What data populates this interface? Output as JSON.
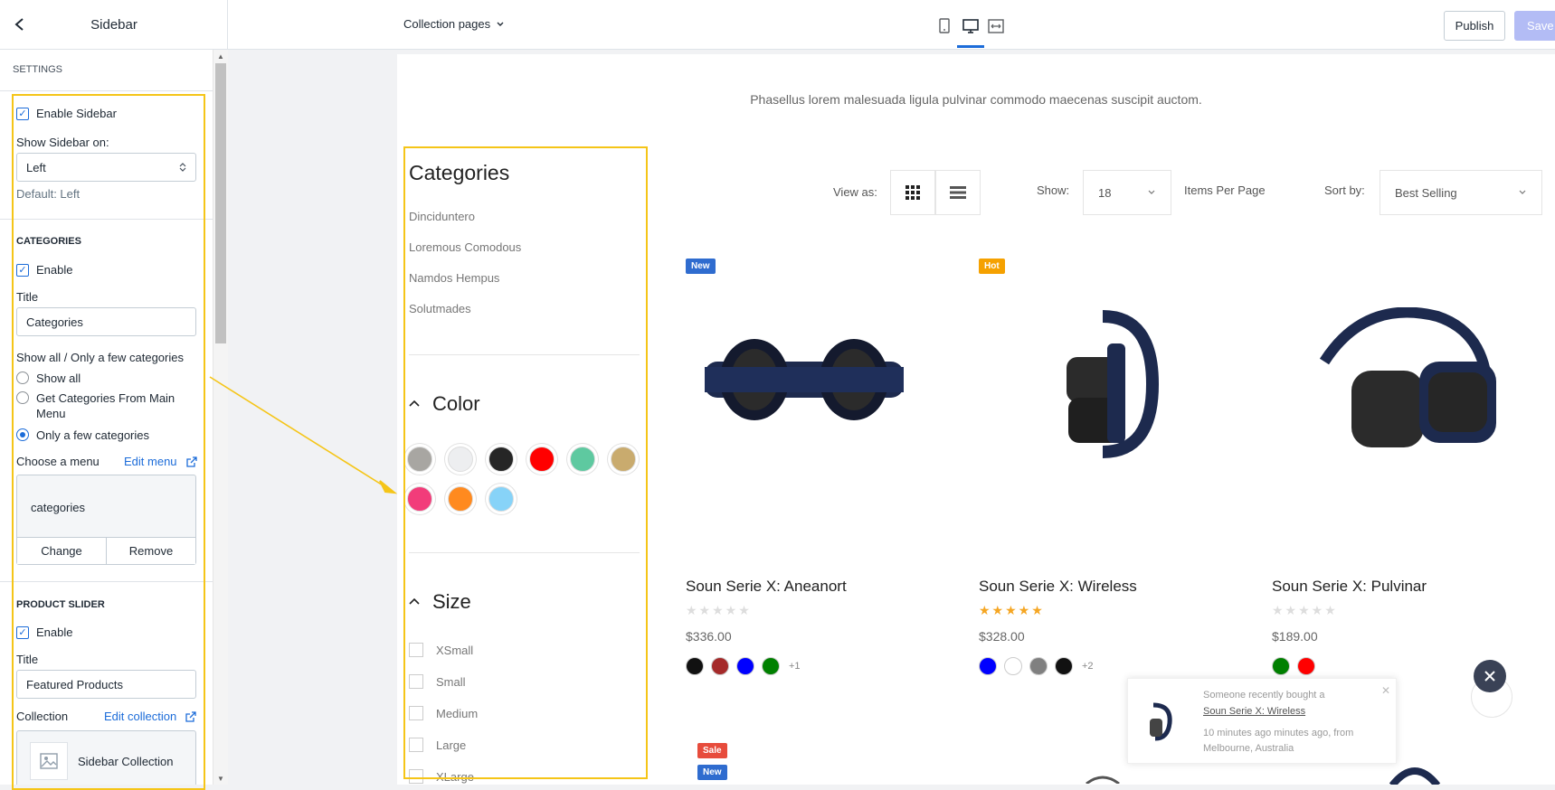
{
  "topbar": {
    "title": "Sidebar",
    "page_selector": "Collection pages",
    "publish_label": "Publish",
    "save_label": "Save"
  },
  "panel": {
    "settings_heading": "SETTINGS",
    "enable_sidebar_label": "Enable Sidebar",
    "show_sidebar_on_label": "Show Sidebar on:",
    "show_sidebar_on_value": "Left",
    "default_hint": "Default: Left",
    "categories": {
      "heading": "CATEGORIES",
      "enable_label": "Enable",
      "title_label": "Title",
      "title_value": "Categories",
      "show_label": "Show all / Only a few categories",
      "options": [
        "Show all",
        "Get Categories From Main Menu",
        "Only a few categories"
      ],
      "selected_option": "Only a few categories",
      "choose_menu_label": "Choose a menu",
      "edit_menu_link": "Edit menu",
      "menu_name": "categories",
      "change_label": "Change",
      "remove_label": "Remove"
    },
    "product_slider": {
      "heading": "PRODUCT SLIDER",
      "enable_label": "Enable",
      "title_label": "Title",
      "title_value": "Featured Products",
      "collection_label": "Collection",
      "edit_collection_link": "Edit collection",
      "collection_name": "Sidebar Collection"
    }
  },
  "preview": {
    "tagline": "Phasellus lorem malesuada ligula pulvinar commodo maecenas suscipit auctom.",
    "sidebar": {
      "categories_title": "Categories",
      "categories": [
        "Dinciduntero",
        "Loremous Comodous",
        "Namdos Hempus",
        "Solutmades"
      ],
      "color_title": "Color",
      "colors": [
        "#a8a6a2",
        "#edeef0",
        "#262626",
        "#ff0000",
        "#5ec9a0",
        "#c9ab6e",
        "#f23c7a",
        "#ff8a1f",
        "#87d3f8"
      ],
      "size_title": "Size",
      "sizes": [
        "XSmall",
        "Small",
        "Medium",
        "Large",
        "XLarge"
      ]
    },
    "toolbar": {
      "view_as_label": "View as:",
      "show_label": "Show:",
      "show_value": "18",
      "items_per_page": "Items Per Page",
      "sort_by_label": "Sort by:",
      "sort_value": "Best Selling"
    },
    "products": [
      {
        "badge": "New",
        "name": "Soun Serie X: Aneanort",
        "rating": 0,
        "price": "$336.00",
        "colors": [
          "#111111",
          "#a52a2a",
          "#0000ff",
          "#008000"
        ],
        "more": "+1"
      },
      {
        "badge": "Hot",
        "name": "Soun Serie X: Wireless",
        "rating": 5,
        "price": "$328.00",
        "colors": [
          "#0000ff",
          "#ffffff",
          "#808080",
          "#111111"
        ],
        "more": "+2"
      },
      {
        "badge": "",
        "name": "Soun Serie X: Pulvinar",
        "rating": 0,
        "price": "$189.00",
        "colors": [
          "#008000",
          "#ff0000"
        ],
        "more": ""
      }
    ],
    "next_row_badges": [
      "Sale",
      "New"
    ],
    "toast": {
      "line1": "Someone recently bought a",
      "product": "Soun Serie X: Wireless",
      "line3": "10 minutes ago minutes ago, from Melbourne, Australia"
    }
  },
  "colors": {
    "accent": "#1c6cd9",
    "highlight": "#f5c518",
    "badge_new": "#2f6ccf",
    "badge_hot": "#f5a100",
    "badge_sale": "#e74c3c",
    "star": "#f5a623"
  }
}
